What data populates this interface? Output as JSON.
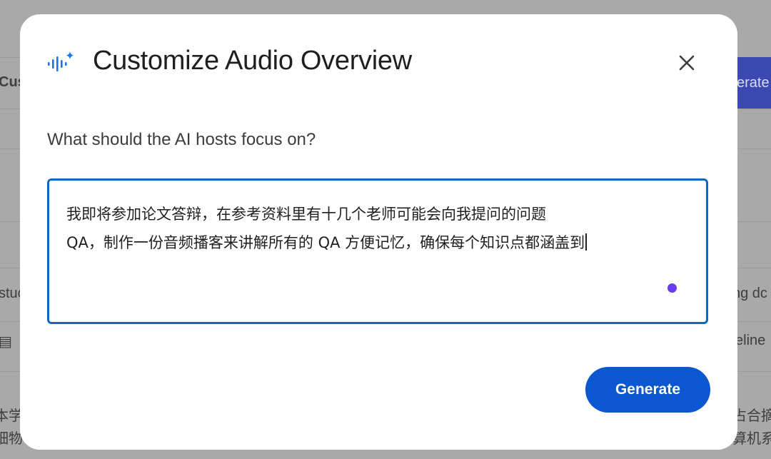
{
  "background": {
    "fragments_left": [
      "Cus",
      "stuc",
      "本学",
      "细物"
    ],
    "fragments_right": [
      "ng dc",
      "eline",
      "占合摘",
      "算机系"
    ],
    "button_fragment": "erate"
  },
  "dialog": {
    "title": "Customize Audio Overview",
    "close_icon": "close-icon",
    "prompt_label": "What should the AI hosts focus on?",
    "textbox_value": "我即将参加论文答辩，在参考资料里有十几个老师可能会向我提问的问题\nQA，制作一份音频播客来讲解所有的 QA 方便记忆，确保每个知识点都涵盖到",
    "generate_label": "Generate"
  },
  "colors": {
    "accent": "#0b57d0",
    "focus_border": "#1565c0",
    "mic_dot": "#6b3cf0",
    "overlay": "#a9a9a9"
  }
}
